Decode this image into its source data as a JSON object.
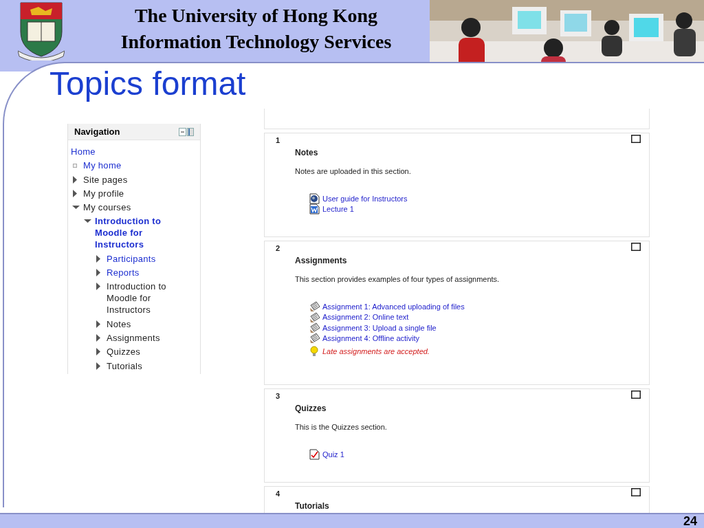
{
  "header": {
    "title_lines": [
      "The University of Hong Kong",
      "Information Technology Services"
    ]
  },
  "slide_title": "Topics format",
  "navigation": {
    "title": "Navigation",
    "items": [
      {
        "label": "Home",
        "kind": "root",
        "link": true
      },
      {
        "label": "My home",
        "kind": "leaf",
        "link": true
      },
      {
        "label": "Site pages",
        "kind": "branch",
        "link": false,
        "expanded": false
      },
      {
        "label": "My profile",
        "kind": "branch",
        "link": false,
        "expanded": false
      },
      {
        "label": "My courses",
        "kind": "branch",
        "link": false,
        "expanded": true,
        "children": [
          {
            "label": "Introduction to Moodle for Instructors",
            "kind": "branch",
            "link": true,
            "current": true,
            "expanded": true,
            "children": [
              {
                "label": "Participants",
                "kind": "branch",
                "link": true,
                "expanded": false
              },
              {
                "label": "Reports",
                "kind": "branch",
                "link": true,
                "expanded": false
              },
              {
                "label": "Introduction to Moodle for Instructors",
                "kind": "branch",
                "link": false,
                "expanded": false
              },
              {
                "label": "Notes",
                "kind": "branch",
                "link": false,
                "expanded": false
              },
              {
                "label": "Assignments",
                "kind": "branch",
                "link": false,
                "expanded": false
              },
              {
                "label": "Quizzes",
                "kind": "branch",
                "link": false,
                "expanded": false
              },
              {
                "label": "Tutorials",
                "kind": "branch",
                "link": false,
                "expanded": false
              }
            ]
          }
        ]
      }
    ]
  },
  "sections": [
    {
      "number": "1",
      "title": "Notes",
      "summary": "Notes are uploaded in this section.",
      "activities": [
        {
          "kind": "resource",
          "label": "User guide for Instructors"
        },
        {
          "kind": "word",
          "label": "Lecture 1"
        }
      ]
    },
    {
      "number": "2",
      "title": "Assignments",
      "summary": "This section provides examples of four types of assignments.",
      "activities": [
        {
          "kind": "assignment",
          "label": "Assignment 1: Advanced uploading of files"
        },
        {
          "kind": "assignment",
          "label": "Assignment 2: Online text"
        },
        {
          "kind": "assignment",
          "label": "Assignment 3: Upload a single file"
        },
        {
          "kind": "assignment",
          "label": "Assignment 4: Offline activity"
        },
        {
          "kind": "label",
          "label": "Late assignments are accepted."
        }
      ]
    },
    {
      "number": "3",
      "title": "Quizzes",
      "summary": "This is the Quizzes section.",
      "activities": [
        {
          "kind": "quiz",
          "label": "Quiz 1"
        }
      ]
    },
    {
      "number": "4",
      "title": "Tutorials"
    }
  ],
  "page_number": "24"
}
